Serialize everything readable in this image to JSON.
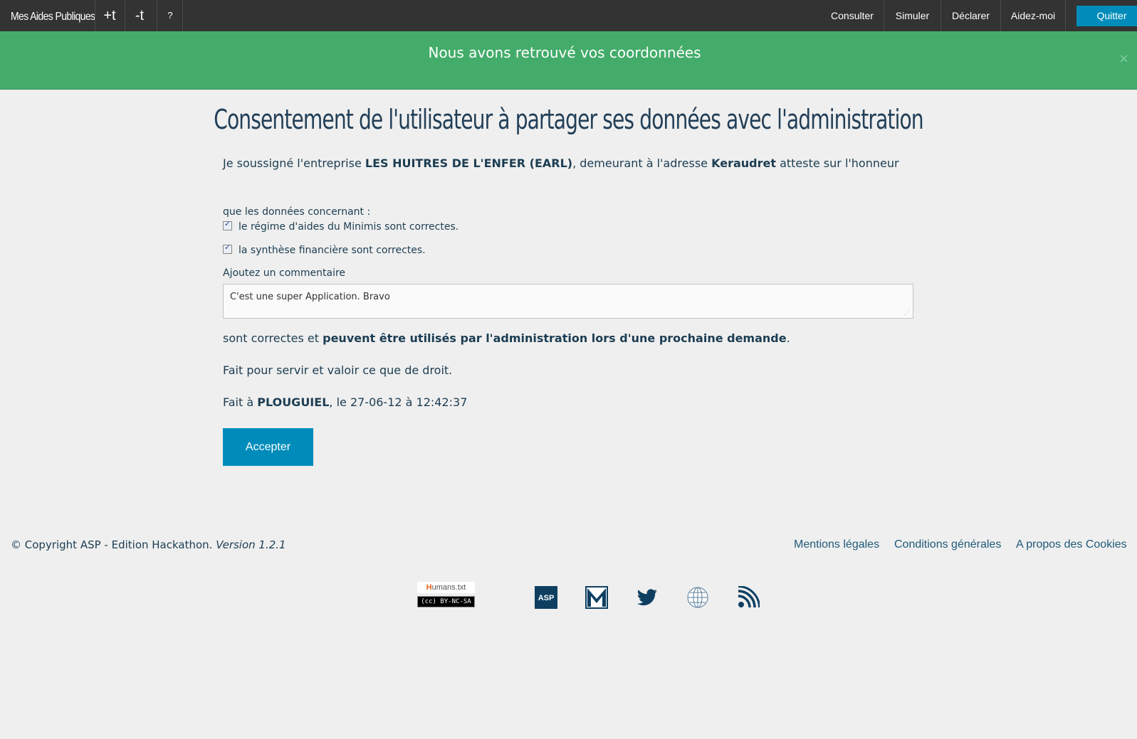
{
  "topbar": {
    "brand": "Mes Aides Publiques",
    "font_increase": "+t",
    "font_decrease": "-t",
    "help": "?",
    "nav": [
      "Consulter",
      "Simuler",
      "Déclarer",
      "Aidez-moi"
    ],
    "quit": "Quitter"
  },
  "alert": {
    "message": "Nous avons retrouvé vos coordonnées",
    "close": "×",
    "color": "#43ac6a"
  },
  "page": {
    "title": "Consentement de l'utilisateur à partager ses données avec l'administration",
    "decl_pre": "Je soussigné l'entreprise ",
    "company": "LES HUITRES DE L'ENFER (EARL)",
    "decl_mid": ", demeurant à l'adresse ",
    "address": "Keraudret",
    "decl_post": " atteste sur l'honneur",
    "concern_label": "que les données concernant :",
    "checks": [
      {
        "label": "le régime d'aides du Minimis sont correctes.",
        "checked": true
      },
      {
        "label": "la synthèse financière sont correctes.",
        "checked": true
      }
    ],
    "comment_label": "Ajoutez un commentaire",
    "comment_value": "C'est une super Application. Bravo",
    "statement_pre": "sont correctes et ",
    "statement_bold": "peuvent être utilisés par l'administration lors d'une prochaine demande",
    "statement_post": ".",
    "fait_servir": "Fait pour servir et valoir ce que de droit.",
    "fait_a_pre": "Fait à ",
    "city": "PLOUGUIEL",
    "fait_a_post": ", le 27-06-12 à 12:42:37",
    "accept": "Accepter"
  },
  "footer": {
    "copyright": "© Copyright ASP - Edition Hackathon. ",
    "version": "Version 1.2.1",
    "links": [
      "Mentions légales",
      "Conditions générales",
      "A propos des Cookies"
    ],
    "humans_badge_prefix": "H",
    "humans_badge_rest": "umans.txt",
    "cc_badge": "(cc) BY-NC-SA",
    "icons": [
      "asp-icon",
      "mail-icon",
      "twitter-icon",
      "globe-icon",
      "rss-icon"
    ],
    "asp_label": "ASP",
    "accent": "#008cba"
  }
}
